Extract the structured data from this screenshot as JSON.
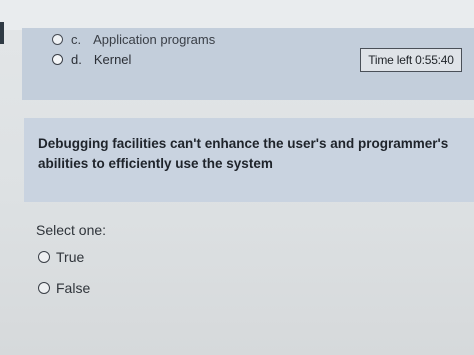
{
  "previous_question": {
    "options": [
      {
        "letter": "c.",
        "label": "Application programs"
      },
      {
        "letter": "d.",
        "label": "Kernel"
      }
    ]
  },
  "timer": {
    "label": "Time left 0:55:40"
  },
  "question": {
    "text": "Debugging facilities can't enhance the user's and programmer's abilities to efficiently use the system",
    "prompt": "Select one:",
    "answers": [
      {
        "label": "True"
      },
      {
        "label": "False"
      }
    ]
  }
}
